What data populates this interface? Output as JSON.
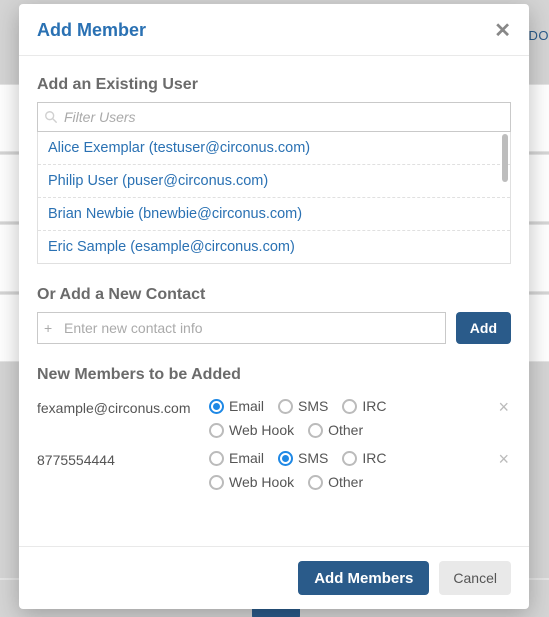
{
  "background": {
    "tab_fragment": "INDO"
  },
  "modal": {
    "title": "Add Member",
    "section_existing": "Add an Existing User",
    "filter_placeholder": "Filter Users",
    "users": [
      "Alice Exemplar (testuser@circonus.com)",
      "Philip User (puser@circonus.com)",
      "Brian Newbie (bnewbie@circonus.com)",
      "Eric Sample (esample@circonus.com)"
    ],
    "section_new_contact": "Or Add a New Contact",
    "new_contact_placeholder": "Enter new contact info",
    "add_button": "Add",
    "section_pending": "New Members to be Added",
    "contact_types": [
      "Email",
      "SMS",
      "IRC",
      "Web Hook",
      "Other"
    ],
    "pending": [
      {
        "label": "fexample@circonus.com",
        "selected": "Email"
      },
      {
        "label": "8775554444",
        "selected": "SMS"
      }
    ],
    "footer": {
      "primary": "Add Members",
      "cancel": "Cancel"
    }
  }
}
